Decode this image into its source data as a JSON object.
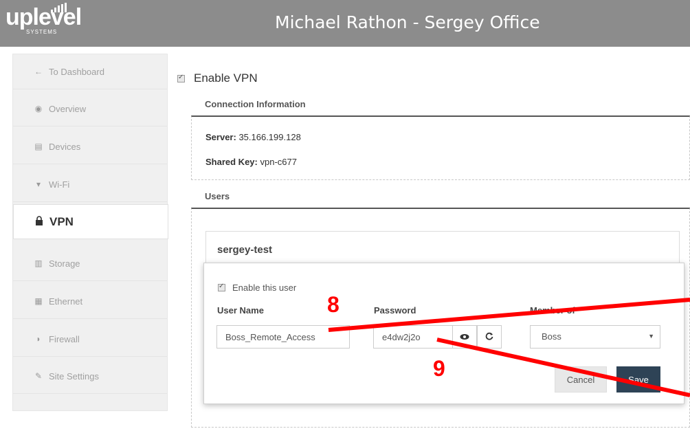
{
  "header": {
    "logo_text": "uplevel",
    "logo_sub": "SYSTEMS",
    "title": "Michael Rathon - Sergey Office"
  },
  "sidebar": {
    "items": [
      {
        "label": "To Dashboard",
        "icon": "arrow-left-icon",
        "glyph": "←"
      },
      {
        "label": "Overview",
        "icon": "eye-icon",
        "glyph": "◉"
      },
      {
        "label": "Devices",
        "icon": "devices-icon",
        "glyph": "▤"
      },
      {
        "label": "Wi-Fi",
        "icon": "wifi-icon",
        "glyph": "▾"
      },
      {
        "label": "VPN",
        "icon": "lock-icon",
        "glyph": "▣"
      },
      {
        "label": "Storage",
        "icon": "storage-icon",
        "glyph": "▥"
      },
      {
        "label": "Ethernet",
        "icon": "ethernet-icon",
        "glyph": "▦"
      },
      {
        "label": "Firewall",
        "icon": "shield-icon",
        "glyph": "◗"
      },
      {
        "label": "Site Settings",
        "icon": "edit-icon",
        "glyph": "✎"
      }
    ]
  },
  "main": {
    "enable_vpn_label": "Enable VPN",
    "connection": {
      "heading": "Connection Information",
      "server_label": "Server:",
      "server_value": "35.166.199.128",
      "shared_key_label": "Shared Key:",
      "shared_key_value": "vpn-c677"
    },
    "users": {
      "heading": "Users",
      "user_title": "sergey-test",
      "enable_user_label": "Enable this user",
      "username_label": "User Name",
      "username_value": "Boss_Remote_Access",
      "password_label": "Password",
      "password_value": "e4dw2j2o",
      "member_label": "Member of",
      "member_value": "Boss",
      "cancel_label": "Cancel",
      "save_label": "Save"
    }
  },
  "annotations": {
    "marker_8": "8",
    "marker_9": "9",
    "color": "#ff0000"
  },
  "colors": {
    "header_bg": "#8c8c8c",
    "save_bg": "#2e4356"
  }
}
